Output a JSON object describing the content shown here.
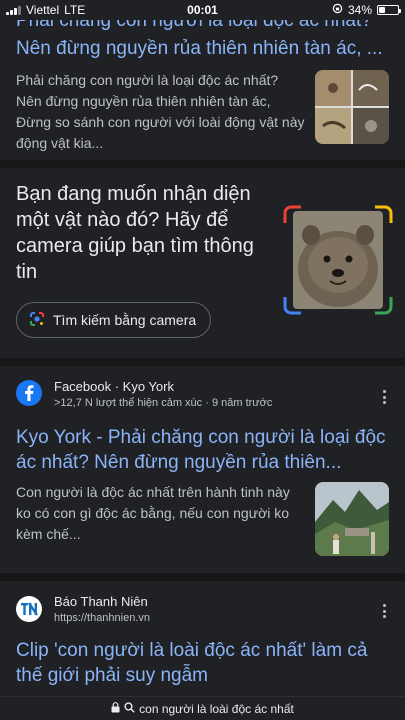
{
  "status_bar": {
    "carrier": "Viettel",
    "network": "LTE",
    "time": "00:01",
    "battery_text": "34%",
    "battery_level": 0.34
  },
  "result_top": {
    "title_cut": "Phải chăng con người là loại độc ác nhất?",
    "title_line2": "Nên đừng nguyền rủa thiên nhiên tàn ác, ...",
    "snippet": "Phải chăng con người là loại độc ác nhất? Nên đừng nguyền rủa thiên nhiên tàn ác, Đừng so sánh con người với loài động vật này động vật kia..."
  },
  "camera_promo": {
    "text": "Bạn đang muốn nhận diện một vật nào đó? Hãy để camera giúp bạn tìm thông tin",
    "button_label": "Tìm kiếm bằng camera"
  },
  "result_facebook": {
    "site": "Facebook · Kyo York",
    "meta": ">12,7 N lượt thể hiện cảm xúc · 9 năm trước",
    "title": "Kyo York - Phải chăng con người là loại độc ác nhất? Nên đừng nguyền rủa thiên...",
    "snippet": "Con người là độc ác nhất trên hành tinh này ko có con gì độc ác bằng, nếu con người ko kèm chế..."
  },
  "result_thanhnien": {
    "site": "Báo Thanh Niên",
    "url": "https://thanhnien.vn",
    "title": "Clip 'con người là loài độc ác nhất' làm cả thế giới phải suy ngẫm"
  },
  "url_bar": {
    "text": "con người là loài độc ác nhất"
  },
  "icons": {
    "lens": "google-lens-icon",
    "facebook": "facebook-icon",
    "thanhnien": "thanhnien-logo-icon",
    "lock": "lock-icon",
    "search": "search-icon"
  },
  "colors": {
    "link": "#8ab4f8",
    "background": "#202124",
    "facebook_blue": "#1877f2",
    "thanhnien_blue": "#1a6ec0"
  }
}
